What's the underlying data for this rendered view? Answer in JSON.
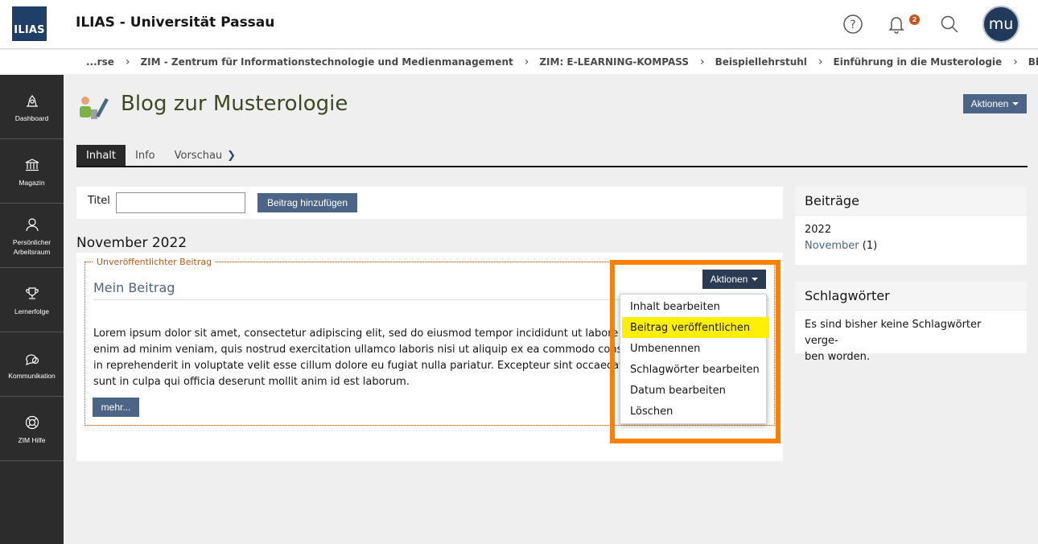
{
  "header": {
    "logo_text": "ILIAS",
    "site_title": "ILIAS - Universität Passau",
    "notification_count": "2",
    "avatar_initials": "mu"
  },
  "breadcrumb": [
    "...rse",
    "ZIM - Zentrum für Informationstechnologie und Medienmanagement",
    "ZIM: E-LEARNING-KOMPASS",
    "Beispiellehrstuhl",
    "Einführung in die Musterologie",
    "Blog zur Musterologie"
  ],
  "mainbar": {
    "items": [
      {
        "label": "Dashboard",
        "icon": "dashboard-icon"
      },
      {
        "label": "Magazin",
        "icon": "repository-icon"
      },
      {
        "label": "Persönlicher Arbeitsraum",
        "icon": "person-icon"
      },
      {
        "label": "Lernerfolge",
        "icon": "trophy-icon"
      },
      {
        "label": "Kommunikation",
        "icon": "chat-icon"
      },
      {
        "label": "ZIM Hilfe",
        "icon": "lifebuoy-icon"
      }
    ]
  },
  "page": {
    "title": "Blog zur Musterologie",
    "actions_label": "Aktionen"
  },
  "tabs": [
    {
      "label": "Inhalt",
      "active": true
    },
    {
      "label": "Info",
      "active": false
    },
    {
      "label": "Vorschau",
      "active": false
    }
  ],
  "add_post": {
    "title_label": "Titel",
    "title_value": "",
    "button_label": "Beitrag hinzufügen"
  },
  "month_heading": "November 2022",
  "post": {
    "status_label": "Unveröffentlichter Beitrag",
    "title": "Mein Beitrag",
    "text_lines": [
      "Lorem ipsum dolor sit amet, consectetur adipiscing elit, sed do eiusmod tempor incididunt ut labore et dolore magna aliqua. Ut",
      "enim ad minim veniam, quis nostrud exercitation ullamco laboris nisi ut aliquip ex ea commodo consequat. Duis aute irure dolor",
      "in reprehenderit in voluptate velit esse cillum dolore eu fugiat nulla pariatur. Excepteur sint occaecat cupidatat non proident,",
      "sunt in culpa qui officia deserunt mollit anim id est laborum."
    ],
    "more_label": "mehr...",
    "actions_label": "Aktionen",
    "dropdown_items": [
      "Inhalt bearbeiten",
      "Beitrag veröffentlichen",
      "Umbenennen",
      "Schlagwörter bearbeiten",
      "Datum bearbeiten",
      "Löschen"
    ],
    "highlighted_item": "Beitrag veröffentlichen"
  },
  "sidebar_panels": {
    "posts": {
      "heading": "Beiträge",
      "year": "2022",
      "month": "November",
      "count": "(1)"
    },
    "tags": {
      "heading": "Schlagwörter",
      "text_line1": "Es sind bisher keine Schlagwörter verge-",
      "text_line2": "ben worden."
    }
  },
  "colors": {
    "highlight_frame": "#ff8000",
    "highlight_item": "#ffef00",
    "button": "#4c6586",
    "mainbar": "#2c2c2c"
  }
}
